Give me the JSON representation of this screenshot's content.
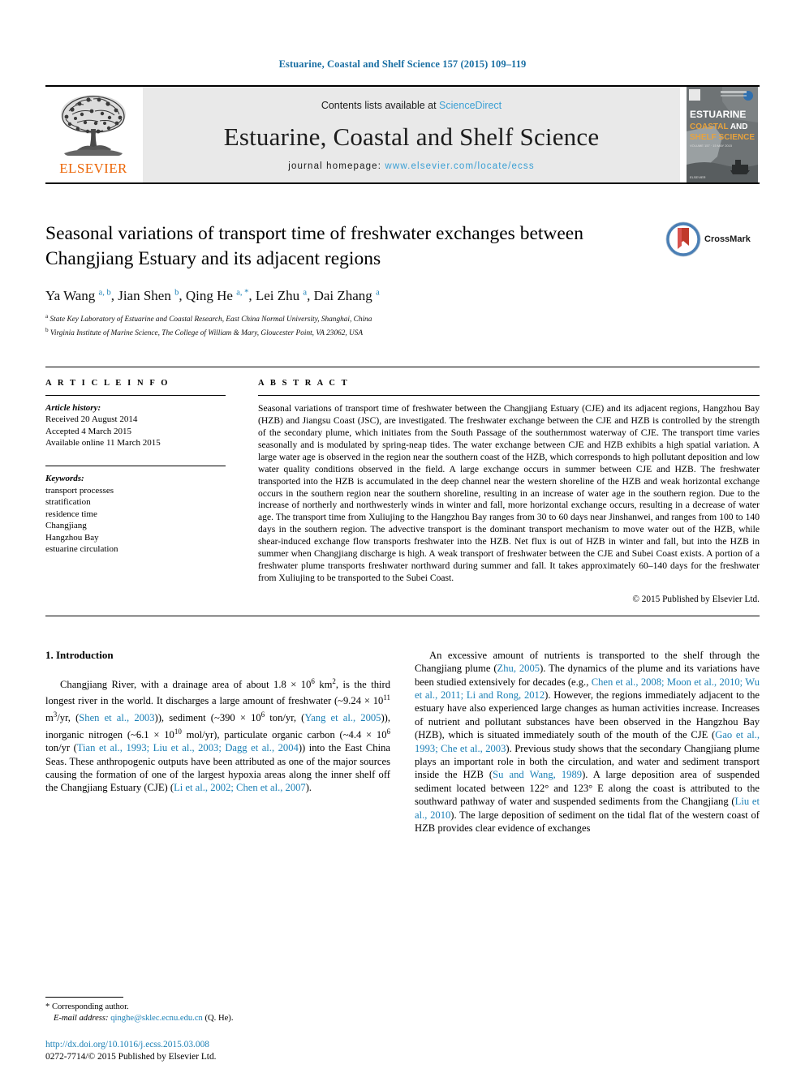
{
  "running_head": "Estuarine, Coastal and Shelf Science 157 (2015) 109–119",
  "masthead": {
    "publisher_name": "ELSEVIER",
    "contents_prefix": "Contents lists available at ",
    "contents_link": "ScienceDirect",
    "journal_name": "Estuarine, Coastal and Shelf Science",
    "homepage_prefix": "journal homepage: ",
    "homepage_url": "www.elsevier.com/locate/ecss",
    "cover": {
      "line1": "ESTUARINE",
      "line2": "COASTAL AND",
      "line3": "SHELF SCIENCE",
      "line4": "VOLUME 157 · 15 MAY 2015"
    }
  },
  "article": {
    "title": "Seasonal variations of transport time of freshwater exchanges between Changjiang Estuary and its adjacent regions",
    "crossmark_label": "CrossMark",
    "authors": [
      {
        "name": "Ya Wang",
        "marks": "a, b",
        "sep": ", "
      },
      {
        "name": "Jian Shen",
        "marks": "b",
        "sep": ", "
      },
      {
        "name": "Qing He",
        "marks": "a, *",
        "sep": ", "
      },
      {
        "name": "Lei Zhu",
        "marks": "a",
        "sep": ", "
      },
      {
        "name": "Dai Zhang",
        "marks": "a",
        "sep": ""
      }
    ],
    "affiliations": [
      {
        "mark": "a",
        "text": "State Key Laboratory of Estuarine and Coastal Research, East China Normal University, Shanghai, China"
      },
      {
        "mark": "b",
        "text": "Virginia Institute of Marine Science, The College of William & Mary, Gloucester Point, VA 23062, USA"
      }
    ]
  },
  "article_info": {
    "heading": "A R T I C L E   I N F O",
    "history_label": "Article history:",
    "history": [
      "Received 20 August 2014",
      "Accepted 4 March 2015",
      "Available online 11 March 2015"
    ],
    "keywords_label": "Keywords:",
    "keywords": [
      "transport processes",
      "stratification",
      "residence time",
      "Changjiang",
      "Hangzhou Bay",
      "estuarine circulation"
    ]
  },
  "abstract": {
    "heading": "A B S T R A C T",
    "text": "Seasonal variations of transport time of freshwater between the Changjiang Estuary (CJE) and its adjacent regions, Hangzhou Bay (HZB) and Jiangsu Coast (JSC), are investigated. The freshwater exchange between the CJE and HZB is controlled by the strength of the secondary plume, which initiates from the South Passage of the southernmost waterway of CJE. The transport time varies seasonally and is modulated by spring-neap tides. The water exchange between CJE and HZB exhibits a high spatial variation. A large water age is observed in the region near the southern coast of the HZB, which corresponds to high pollutant deposition and low water quality conditions observed in the field. A large exchange occurs in summer between CJE and HZB. The freshwater transported into the HZB is accumulated in the deep channel near the western shoreline of the HZB and weak horizontal exchange occurs in the southern region near the southern shoreline, resulting in an increase of water age in the southern region. Due to the increase of northerly and northwesterly winds in winter and fall, more horizontal exchange occurs, resulting in a decrease of water age. The transport time from Xuliujing to the Hangzhou Bay ranges from 30 to 60 days near Jinshanwei, and ranges from 100 to 140 days in the southern region. The advective transport is the dominant transport mechanism to move water out of the HZB, while shear-induced exchange flow transports freshwater into the HZB. Net flux is out of HZB in winter and fall, but into the HZB in summer when Changjiang discharge is high. A weak transport of freshwater between the CJE and Subei Coast exists. A portion of a freshwater plume transports freshwater northward during summer and fall. It takes approximately 60–140 days for the freshwater from Xuliujing to be transported to the Subei Coast.",
    "copyright": "© 2015 Published by Elsevier Ltd."
  },
  "introduction": {
    "section_title": "1.  Introduction",
    "left_paragraph_parts": [
      {
        "t": "Changjiang River, with a drainage area of about 1.8 × 10"
      },
      {
        "sup": "6"
      },
      {
        "t": " km"
      },
      {
        "sup": "2"
      },
      {
        "t": ", is the third longest river in the world. It discharges a large amount of freshwater (~9.24 × 10"
      },
      {
        "sup": "11"
      },
      {
        "t": " m"
      },
      {
        "sup": "3"
      },
      {
        "t": "/yr, ("
      },
      {
        "link": "Shen et al., 2003"
      },
      {
        "t": ")), sediment (~390 × 10"
      },
      {
        "sup": "6"
      },
      {
        "t": " ton/yr, ("
      },
      {
        "link": "Yang et al., 2005"
      },
      {
        "t": ")), inorganic nitrogen (~6.1 × 10"
      },
      {
        "sup": "10"
      },
      {
        "t": " mol/yr), particulate organic carbon (~4.4 × 10"
      },
      {
        "sup": "6"
      },
      {
        "t": " ton/yr ("
      },
      {
        "link": "Tian et al., 1993; Liu et al., 2003; Dagg et al., 2004"
      },
      {
        "t": ")) into the East China Seas. These anthropogenic outputs have been attributed as one of the major sources causing the formation of one of the largest hypoxia areas along the inner shelf off the Changjiang Estuary (CJE) ("
      },
      {
        "link": "Li et al., 2002; Chen et al., 2007"
      },
      {
        "t": ")."
      }
    ],
    "right_paragraph_parts": [
      {
        "t": "An excessive amount of nutrients is transported to the shelf through the Changjiang plume ("
      },
      {
        "link": "Zhu, 2005"
      },
      {
        "t": "). The dynamics of the plume and its variations have been studied extensively for decades (e.g., "
      },
      {
        "link": "Chen et al., 2008; Moon et al., 2010; Wu et al., 2011; Li and Rong, 2012"
      },
      {
        "t": "). However, the regions immediately adjacent to the estuary have also experienced large changes as human activities increase. Increases of nutrient and pollutant substances have been observed in the Hangzhou Bay (HZB), which is situated immediately south of the mouth of the CJE ("
      },
      {
        "link": "Gao et al., 1993; Che et al., 2003"
      },
      {
        "t": "). Previous study shows that the secondary Changjiang plume plays an important role in both the circulation, and water and sediment transport inside the HZB ("
      },
      {
        "link": "Su and Wang, 1989"
      },
      {
        "t": "). A large deposition area of suspended sediment located between 122° and 123° E along the coast is attributed to the southward pathway of water and suspended sediments from the Changjiang ("
      },
      {
        "link": "Liu et al., 2010"
      },
      {
        "t": "). The large deposition of sediment on the tidal flat of the western coast of HZB provides clear evidence of exchanges"
      }
    ]
  },
  "footnote": {
    "corresponding_author": "* Corresponding author.",
    "email_label": "E-mail address:",
    "email": "qinghe@sklec.ecnu.edu.cn",
    "email_owner": "(Q. He)."
  },
  "footer": {
    "doi": "http://dx.doi.org/10.1016/j.ecss.2015.03.008",
    "issn_line": "0272-7714/© 2015 Published by Elsevier Ltd."
  },
  "colors": {
    "link_blue": "#1a7fb5",
    "sciencedirect_blue": "#3a9fd4",
    "elsevier_orange": "#ec6607",
    "band_gray": "#e9e9e9"
  }
}
